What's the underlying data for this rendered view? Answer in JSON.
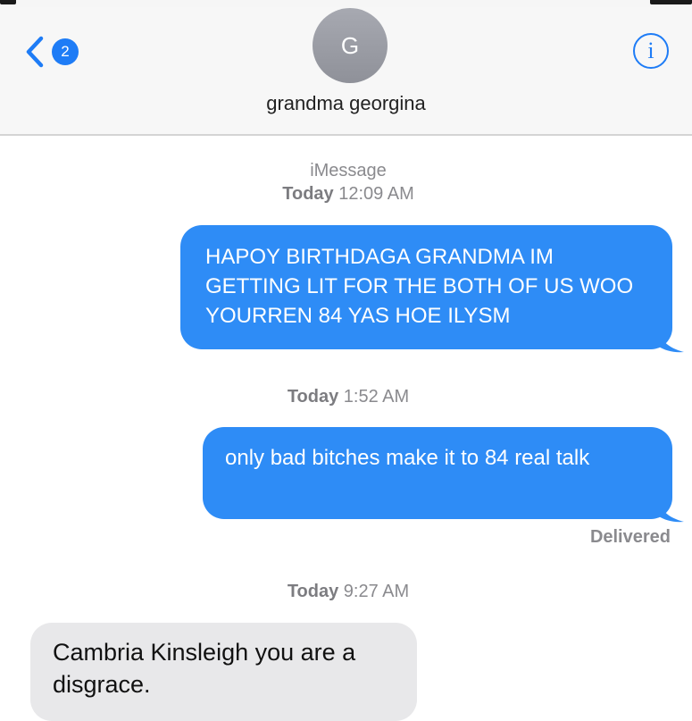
{
  "header": {
    "back_badge": "2",
    "avatar_initial": "G",
    "contact_name": "grandma georgina",
    "info_symbol": "i",
    "accent_color": "#1e7cf6"
  },
  "thread": {
    "service": "iMessage",
    "stamps": [
      {
        "day": "Today",
        "time": "12:09 AM"
      },
      {
        "day": "Today",
        "time": "1:52 AM"
      },
      {
        "day": "Today",
        "time": "9:27 AM"
      }
    ],
    "messages": [
      {
        "direction": "outgoing",
        "text": "HAPOY BIRTHDAGA GRANDMA IM GETTING LIT FOR THE BOTH OF US WOO YOURREN 84 YAS HOE ILYSM"
      },
      {
        "direction": "outgoing",
        "text": "only bad bitches make it to 84 real talk"
      },
      {
        "direction": "incoming",
        "text": "Cambria Kinsleigh you are a disgrace."
      }
    ],
    "delivered_label": "Delivered",
    "outgoing_color": "#2e8cf6",
    "incoming_color": "#e8e8ea"
  }
}
